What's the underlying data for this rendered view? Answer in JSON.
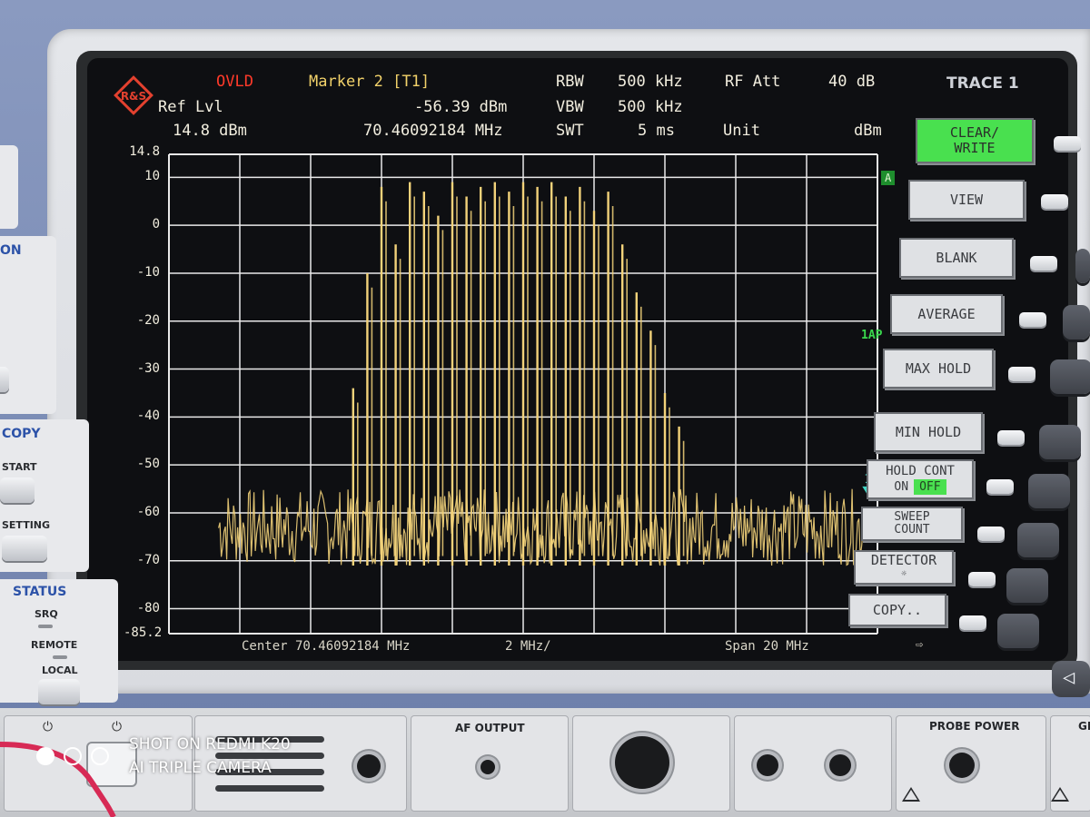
{
  "header": {
    "status": "OVLD",
    "ref_lvl_label": "Ref Lvl",
    "ref_lvl_value": "14.8 dBm",
    "marker_label": "Marker 2 [T1]",
    "marker_level": "-56.39 dBm",
    "marker_freq": "70.46092184 MHz",
    "rbw_label": "RBW",
    "rbw_value": "500 kHz",
    "vbw_label": "VBW",
    "vbw_value": "500 kHz",
    "swt_label": "SWT",
    "swt_value": "5 ms",
    "rf_att_label": "RF Att",
    "rf_att_value": "40 dB",
    "unit_label": "Unit",
    "unit_value": "dBm",
    "trace_menu_title": "TRACE 1"
  },
  "chart_data": {
    "type": "line",
    "ylim": [
      -85.2,
      14.8
    ],
    "y_top_label": "14.8",
    "y_bottom_label": "-85.2",
    "yticks": [
      "10",
      "0",
      "-10",
      "-20",
      "-30",
      "-40",
      "-50",
      "-60",
      "-70",
      "-80"
    ],
    "ytick_values": [
      10,
      0,
      -10,
      -20,
      -30,
      -40,
      -50,
      -60,
      -70,
      -80
    ],
    "x_divisions": 10,
    "noise_floor_dbm": -63,
    "comb_lines": [
      {
        "x": 0.26,
        "y": -34
      },
      {
        "x": 0.28,
        "y": -10
      },
      {
        "x": 0.3,
        "y": 8
      },
      {
        "x": 0.32,
        "y": -4
      },
      {
        "x": 0.34,
        "y": 9
      },
      {
        "x": 0.36,
        "y": 7
      },
      {
        "x": 0.38,
        "y": 2
      },
      {
        "x": 0.4,
        "y": 9
      },
      {
        "x": 0.42,
        "y": 6
      },
      {
        "x": 0.44,
        "y": 8
      },
      {
        "x": 0.46,
        "y": 9
      },
      {
        "x": 0.48,
        "y": 7
      },
      {
        "x": 0.5,
        "y": 9
      },
      {
        "x": 0.52,
        "y": 8
      },
      {
        "x": 0.54,
        "y": 9
      },
      {
        "x": 0.56,
        "y": 6
      },
      {
        "x": 0.58,
        "y": 8
      },
      {
        "x": 0.6,
        "y": 3
      },
      {
        "x": 0.62,
        "y": 7
      },
      {
        "x": 0.64,
        "y": -4
      },
      {
        "x": 0.66,
        "y": -14
      },
      {
        "x": 0.68,
        "y": -22
      },
      {
        "x": 0.7,
        "y": -35
      },
      {
        "x": 0.72,
        "y": -42
      }
    ],
    "marker": {
      "label": "1",
      "x": 0.985,
      "y": -56.39
    },
    "trace_flag": "A",
    "detector_flag": "1AP",
    "center_label": "Center 70.46092184 MHz",
    "div_label": "2 MHz/",
    "span_label": "Span 20 MHz",
    "trace_color": "#f2d27a",
    "grid_color": "#e9e9e9"
  },
  "softkeys": {
    "clear_write": "CLEAR/\nWRITE",
    "view": "VIEW",
    "blank": "BLANK",
    "average": "AVERAGE",
    "max_hold": "MAX HOLD",
    "min_hold": "MIN HOLD",
    "hold_cont": "HOLD CONT",
    "hold_on": "ON",
    "hold_off": "OFF",
    "sweep_count": "SWEEP\nCOUNT",
    "detector": "DETECTOR",
    "copy": "COPY.."
  },
  "left_panel": {
    "on_fragment": "ON",
    "copy_title": "COPY",
    "start_label": "START",
    "setting_label": "SETTING",
    "status_title": "STATUS",
    "srq_label": "SRQ",
    "remote_label": "REMOTE",
    "local_label": "LOCAL"
  },
  "bottom_panel": {
    "af_output": "AF OUTPUT",
    "probe_power": "PROBE POWER",
    "gen_fragment": "GE"
  },
  "watermark": {
    "line1": "SHOT ON REDMI K20",
    "line2": "AI TRIPLE CAMERA"
  },
  "colors": {
    "active_softkey": "#49e04f",
    "screen_bg": "#0e0f12",
    "ovld": "#ff3a2a",
    "marker_text": "#f2d26a",
    "panel_blue": "#7c8db6"
  }
}
